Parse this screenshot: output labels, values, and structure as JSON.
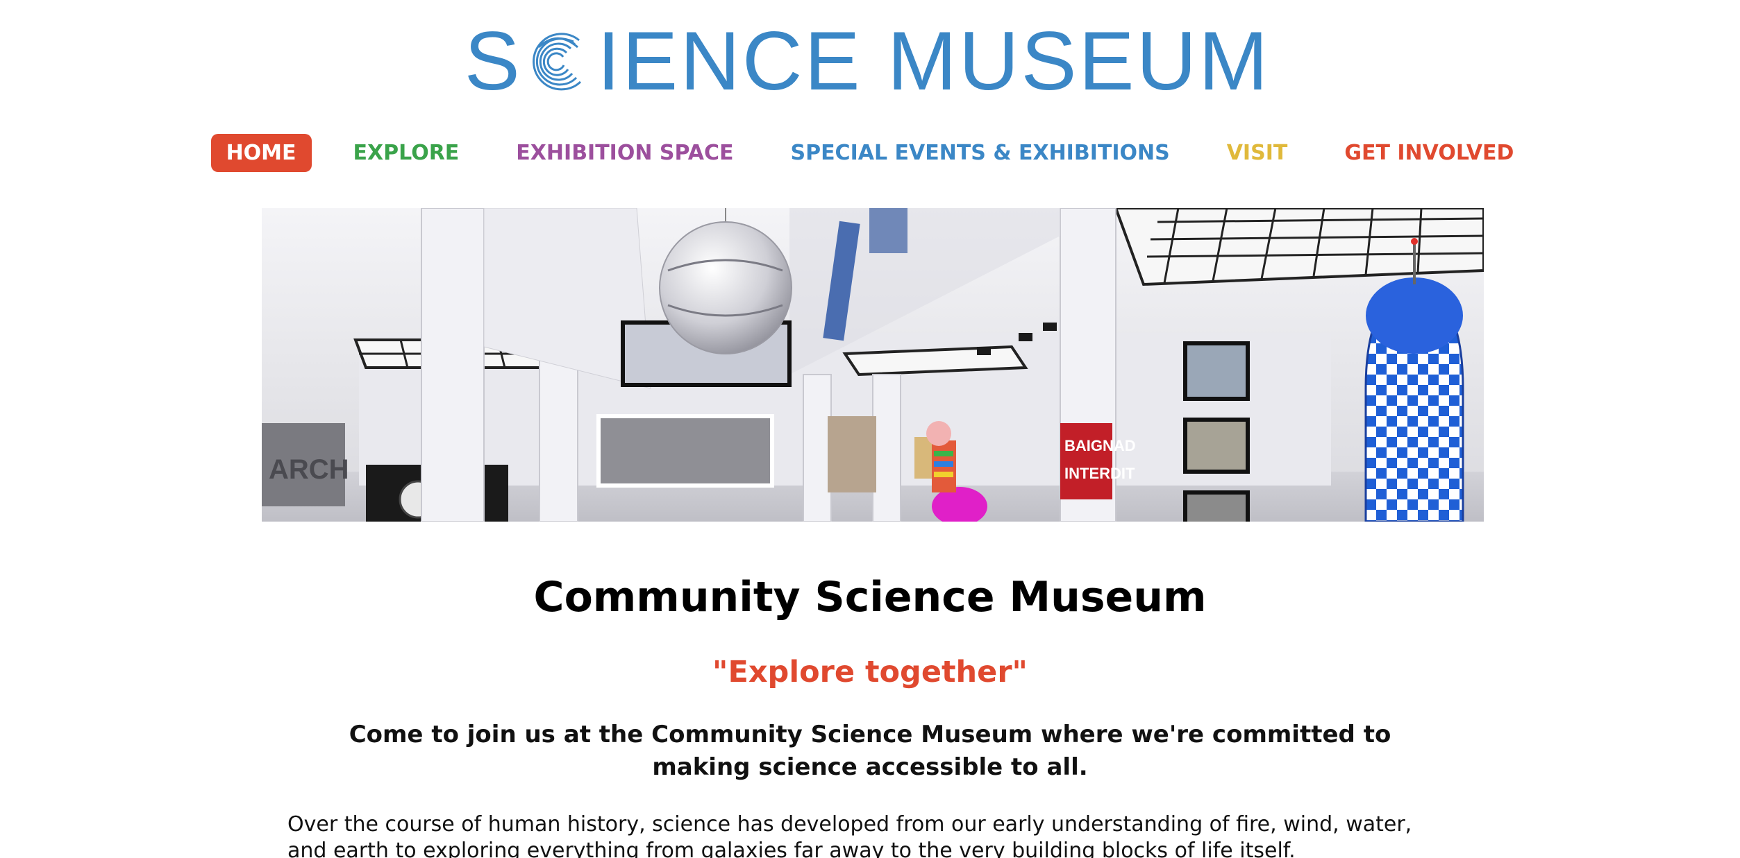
{
  "logo": {
    "left_text": "S",
    "right_text": "IENCE MUSEUM",
    "icon": "swirl-c-icon",
    "color": "#3b87c6"
  },
  "nav": {
    "items": [
      {
        "label": "HOME",
        "color": "#ffffff",
        "active": true
      },
      {
        "label": "EXPLORE",
        "color": "#3aa34a"
      },
      {
        "label": "EXHIBITION SPACE",
        "color": "#9c4f9d"
      },
      {
        "label": "SPECIAL EVENTS & EXHIBITIONS",
        "color": "#3b87c6"
      },
      {
        "label": "VISIT",
        "color": "#e0b93b"
      },
      {
        "label": "GET INVOLVED",
        "color": "#e0492f"
      }
    ],
    "active_bg": "#e0492f"
  },
  "hero": {
    "sign_text": "BAIGNAD INTERDIT"
  },
  "content": {
    "title": "Community Science Museum",
    "tagline": "\"Explore together\"",
    "intro": "Come to join us at the Community Science Museum where we're committed to making science accessible to all.",
    "body": "Over the course of human history, science has developed from our early understanding of fire, wind, water, and earth to exploring everything from galaxies far away to the very building blocks of life itself."
  }
}
